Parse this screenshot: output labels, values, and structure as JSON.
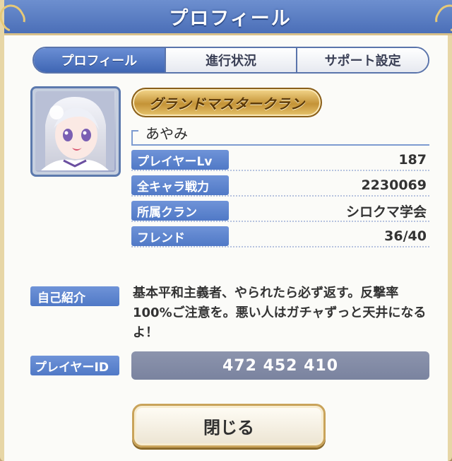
{
  "header": {
    "title": "プロフィール"
  },
  "tabs": [
    {
      "label": "プロフィール",
      "active": true
    },
    {
      "label": "進行状況",
      "active": false
    },
    {
      "label": "サポート設定",
      "active": false
    }
  ],
  "profile": {
    "clan_rank_banner": "グランドマスタークラン",
    "name": "あやみ",
    "stats": [
      {
        "label": "プレイヤーLv",
        "value": "187"
      },
      {
        "label": "全キャラ戦力",
        "value": "2230069"
      },
      {
        "label": "所属クラン",
        "value": "シロクマ学会"
      },
      {
        "label": "フレンド",
        "value": "36/40"
      }
    ],
    "intro_label": "自己紹介",
    "intro_text": "基本平和主義者、やられたら必ず返す。反撃率100%ご注意を。悪い人はガチャずっと天井になるよ！",
    "player_id_label": "プレイヤーID",
    "player_id": "472 452 410"
  },
  "footer": {
    "close_label": "閉じる"
  },
  "colors": {
    "accent": "#5079c6",
    "title_bar": "#4b6fb8",
    "gold": "#c49337",
    "id_box": "#7a839f"
  }
}
